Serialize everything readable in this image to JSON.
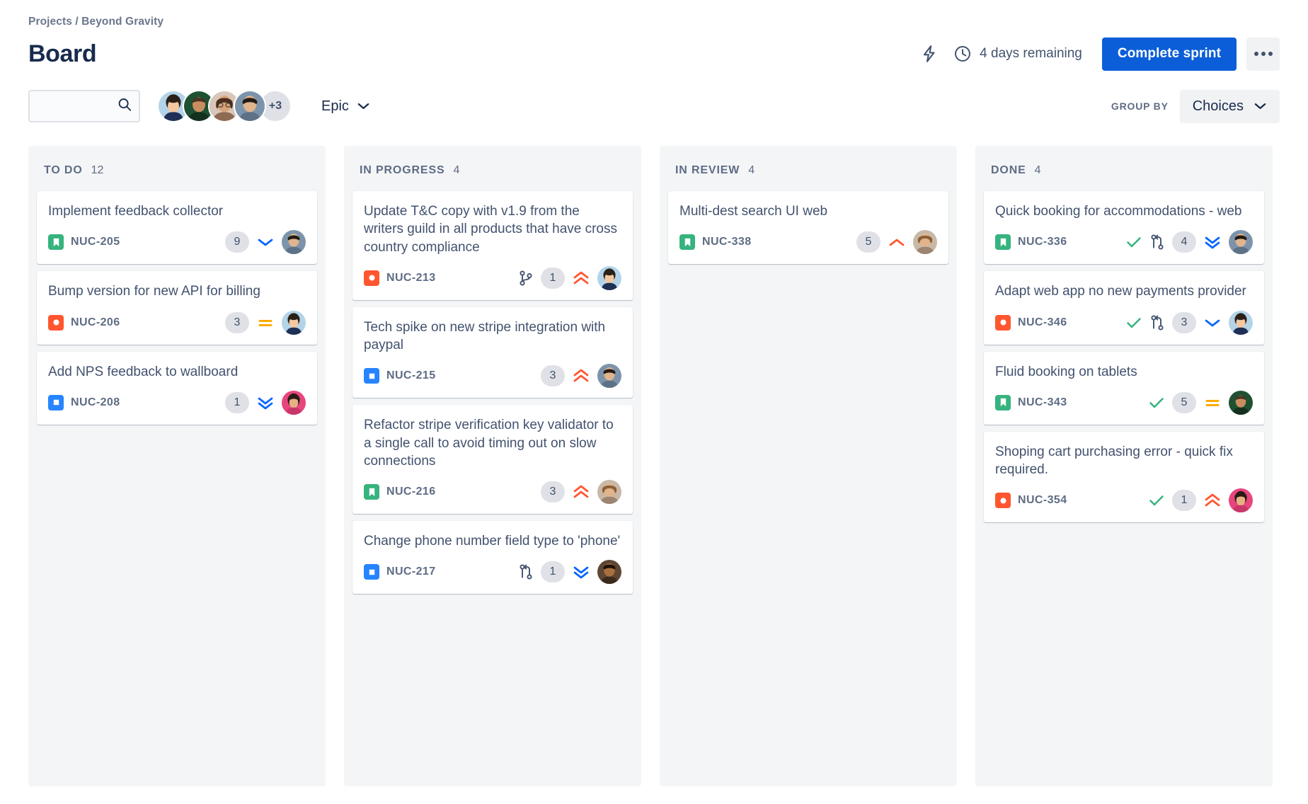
{
  "header": {
    "breadcrumb": "Projects / Beyond Gravity",
    "title": "Board",
    "sprint_days": "4 days remaining",
    "complete_sprint_label": "Complete sprint",
    "bolt_icon": "lightning-bolt-icon",
    "clock_icon": "clock-icon",
    "more_icon": "more-options-icon"
  },
  "filters": {
    "search_placeholder": "",
    "search_value": "",
    "search_icon": "search-icon",
    "avatar_overflow": "+3",
    "epic_label": "Epic",
    "group_by_label": "GROUP BY",
    "group_by_value": "Choices",
    "chevron_icon": "chevron-down-icon"
  },
  "colors": {
    "primary": "#0B5ED7",
    "story": "#36B37E",
    "bug": "#FF5630",
    "task": "#2684FF",
    "done_check": "#36B37E",
    "priority_highest": "#FF5630",
    "priority_high": "#FF5630",
    "priority_medium": "#FFAB00",
    "priority_low": "#0065FF",
    "priority_lowest": "#0065FF",
    "column_bg": "#F4F5F7"
  },
  "columns": [
    {
      "name": "TO DO",
      "count": "12",
      "cards": [
        {
          "title": "Implement feedback collector",
          "key": "NUC-205",
          "type": "story",
          "done": false,
          "dev_icon": "",
          "badge": "9",
          "priority": "low",
          "avatar": "a1"
        },
        {
          "title": "Bump version for new API for billing",
          "key": "NUC-206",
          "type": "bug",
          "done": false,
          "dev_icon": "",
          "badge": "3",
          "priority": "medium",
          "avatar": "a2"
        },
        {
          "title": "Add NPS feedback to wallboard",
          "key": "NUC-208",
          "type": "task",
          "done": false,
          "dev_icon": "",
          "badge": "1",
          "priority": "lowest",
          "avatar": "a3"
        }
      ]
    },
    {
      "name": "IN PROGRESS",
      "count": "4",
      "cards": [
        {
          "title": "Update T&C copy with v1.9 from the writers guild in all products that have cross country compliance",
          "key": "NUC-213",
          "type": "bug",
          "done": false,
          "dev_icon": "branch-icon",
          "badge": "1",
          "priority": "highest",
          "avatar": "a2"
        },
        {
          "title": "Tech spike on new stripe integration with paypal",
          "key": "NUC-215",
          "type": "task",
          "done": false,
          "dev_icon": "",
          "badge": "3",
          "priority": "highest",
          "avatar": "a1"
        },
        {
          "title": "Refactor stripe verification key validator to a single call to avoid timing out on slow connections",
          "key": "NUC-216",
          "type": "story",
          "done": false,
          "dev_icon": "",
          "badge": "3",
          "priority": "highest",
          "avatar": "a4"
        },
        {
          "title": "Change phone number field type to 'phone'",
          "key": "NUC-217",
          "type": "task",
          "done": false,
          "dev_icon": "pull-request-icon",
          "badge": "1",
          "priority": "lowest",
          "avatar": "a5"
        }
      ]
    },
    {
      "name": "IN REVIEW",
      "count": "4",
      "cards": [
        {
          "title": "Multi-dest search UI web",
          "key": "NUC-338",
          "type": "story",
          "done": false,
          "dev_icon": "",
          "badge": "5",
          "priority": "high",
          "avatar": "a4"
        }
      ]
    },
    {
      "name": "DONE",
      "count": "4",
      "cards": [
        {
          "title": "Quick booking for accommodations - web",
          "key": "NUC-336",
          "type": "story",
          "done": true,
          "dev_icon": "pull-request-icon",
          "badge": "4",
          "priority": "lowest",
          "avatar": "a1"
        },
        {
          "title": "Adapt web app no new payments provider",
          "key": "NUC-346",
          "type": "bug",
          "done": true,
          "dev_icon": "pull-request-icon",
          "badge": "3",
          "priority": "low",
          "avatar": "a2"
        },
        {
          "title": "Fluid booking on tablets",
          "key": "NUC-343",
          "type": "story",
          "done": true,
          "dev_icon": "",
          "badge": "5",
          "priority": "medium",
          "avatar": "a6"
        },
        {
          "title": "Shoping cart purchasing error - quick fix required.",
          "key": "NUC-354",
          "type": "bug",
          "done": true,
          "dev_icon": "",
          "badge": "1",
          "priority": "highest",
          "avatar": "a3"
        }
      ]
    }
  ]
}
